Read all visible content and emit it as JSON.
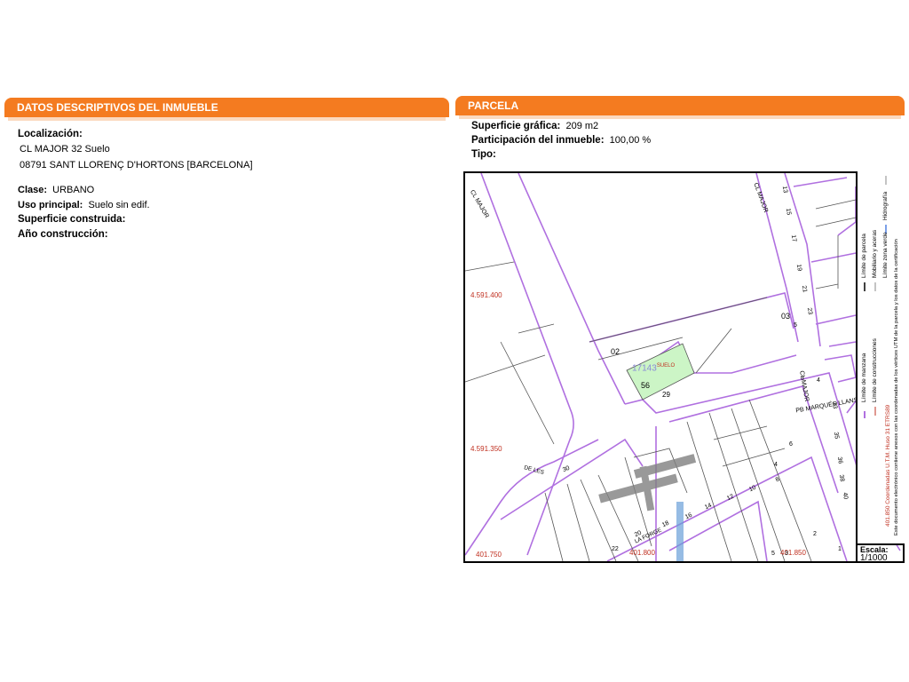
{
  "left_section": {
    "title": "DATOS DESCRIPTIVOS DEL INMUEBLE",
    "localizacion_label": "Localización:",
    "address_line1": "CL MAJOR 32 Suelo",
    "address_line2": "08791 SANT LLORENÇ D'HORTONS [BARCELONA]",
    "clase_label": "Clase:",
    "clase_value": "URBANO",
    "uso_label": "Uso principal:",
    "uso_value": "Suelo sin edif.",
    "superficie_construida_label": "Superficie construida:",
    "anio_label": "Año construcción:"
  },
  "right_section": {
    "title": "PARCELA",
    "superficie_label": "Superficie gráfica:",
    "superficie_value": "209 m2",
    "participacion_label": "Participación del inmueble:",
    "participacion_value": "100,00 %",
    "tipo_label": "Tipo:"
  },
  "map": {
    "coord_top": "4.591.400",
    "coord_mid": "4.591.350",
    "coord_bottom_left": "401.750",
    "coord_bottom_mid": "401.800",
    "coord_bottom_right": "401.850",
    "parcel_ref": "17143",
    "parcel_suelo": "SUELO",
    "label_02": "02",
    "label_03": "03",
    "label_56": "56",
    "label_29": "29",
    "street_major_top": "CL MAJOR",
    "street_major_mid": "CL MAJOR",
    "street_major_bottom": "CL MAJOR",
    "street_pb": "PB MARQUÉS LLANSA",
    "street_les": "DE LES",
    "street_forge": "LA FORGE",
    "label_30": "30",
    "numbers_right": [
      "13",
      "15",
      "17",
      "19",
      "21",
      "23",
      "5",
      "3",
      "4",
      "33",
      "35",
      "36",
      "38",
      "40",
      "4",
      "2",
      "1"
    ],
    "numbers_bottom": [
      "20",
      "18",
      "16",
      "14",
      "12",
      "10",
      "8",
      "6",
      "22",
      "5",
      "3"
    ]
  },
  "legend": {
    "col1_line1": "Límite de manzana",
    "col1_line2": "Límite de parcela",
    "col2_line1": "Límite de construcciones",
    "col2_line2": "Mobiliario y aceras",
    "col3_line1": "Hidrografía",
    "col3_line2": "Límite zona verde",
    "utm_note": "401.850 Coordenadas U.T.M. Huso 31 ETRS89",
    "disclaimer": "Este documento electrónico contiene anexos con las coordenadas de los vértices UTM de la parcela y los datos de la certificación"
  },
  "scale": {
    "label": "Escala:",
    "value": "1/1000"
  },
  "colors": {
    "banner": "#f47b20",
    "parcel_fill": "#ccf5c6",
    "block_line": "#b070e0",
    "coord_text": "#c03020"
  }
}
